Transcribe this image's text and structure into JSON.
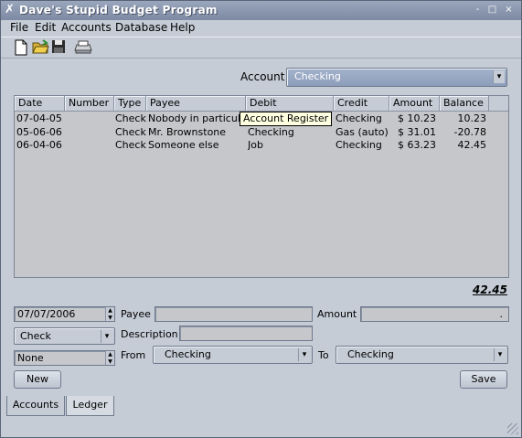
{
  "window": {
    "title": "Dave's Stupid Budget Program"
  },
  "titlebar_buttons": {
    "minimize": "-",
    "maximize": "□",
    "close": "×"
  },
  "menubar": {
    "file": "File",
    "edit": "Edit",
    "accounts": "Accounts",
    "database": "Database",
    "help": "Help"
  },
  "toolbar": {
    "icons": [
      "new-document-icon",
      "open-folder-icon",
      "save-disk-icon",
      "print-icon"
    ]
  },
  "account_selector": {
    "label": "Account",
    "value": "Checking"
  },
  "ledger": {
    "columns": [
      "Date",
      "Number",
      "Type",
      "Payee",
      "Debit",
      "Credit",
      "Amount",
      "Balance"
    ],
    "rows": [
      {
        "date": "07-04-05",
        "number": "",
        "type": "Check",
        "payee": "Nobody in particular",
        "debit": "",
        "credit": "Checking",
        "amount": "$ 10.23",
        "balance": "10.23"
      },
      {
        "date": "05-06-06",
        "number": "",
        "type": "Check",
        "payee": "Mr. Brownstone",
        "debit": "Checking",
        "credit": "Gas (auto)",
        "amount": "$ 31.01",
        "balance": "-20.78"
      },
      {
        "date": "06-04-06",
        "number": "",
        "type": "Check",
        "payee": "Someone else",
        "debit": "Job",
        "credit": "Checking",
        "amount": "$ 63.23",
        "balance": "42.45"
      }
    ],
    "tooltip": "Account Register",
    "balance_total": "42.45"
  },
  "form": {
    "date": "07/07/2006",
    "payee_label": "Payee",
    "payee_value": "",
    "amount_label": "Amount",
    "amount_value": ".",
    "type_value": "Check",
    "description_label": "Description",
    "description_value": "",
    "number_value": "None",
    "from_label": "From",
    "from_value": "Checking",
    "to_label": "To",
    "to_value": "Checking",
    "new_button": "New",
    "save_button": "Save"
  },
  "tabs": {
    "accounts": "Accounts",
    "ledger": "Ledger",
    "active": "Ledger"
  }
}
